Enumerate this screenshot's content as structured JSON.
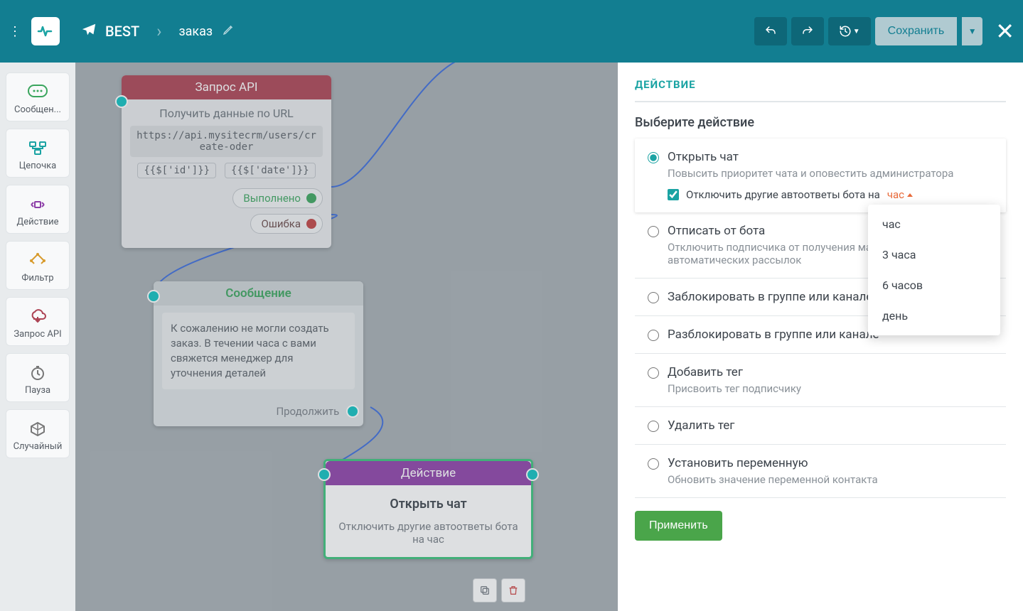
{
  "header": {
    "bot_name": "BEST",
    "flow_name": "заказ",
    "save": "Сохранить"
  },
  "tools": {
    "message": "Сообщен...",
    "chain": "Цепочка",
    "action": "Действие",
    "filter": "Фильтр",
    "api": "Запрос API",
    "pause": "Пауза",
    "random": "Случайный"
  },
  "nodes": {
    "api": {
      "title": "Запрос API",
      "desc": "Получить данные по URL",
      "url": "https://api.mysitecrm/users/create-oder",
      "var1": "{{$['id']}}",
      "var2": "{{$['date']}}",
      "out_done": "Выполнено",
      "out_err": "Ошибка"
    },
    "msg": {
      "title": "Сообщение",
      "text": "К сожалению не могли создать заказ. В течении часа с вами свяжется менеджер для уточнения деталей",
      "out_continue": "Продолжить"
    },
    "act": {
      "title": "Действие",
      "name": "Открыть чат",
      "sub": "Отключить другие автоответы бота на  час"
    }
  },
  "panel": {
    "heading": "ДЕЙСТВИЕ",
    "select_label": "Выберите действие",
    "apply": "Применить",
    "items": {
      "open": {
        "label": "Открыть чат",
        "desc": "Повысить приоритет чата и оповестить администратора",
        "chk": "Отключить другие автоответы бота на",
        "time": "час"
      },
      "unsub": {
        "label": "Отписать от бота",
        "desc": "Отключить подписчика от получения массовых и автоматических рассылок"
      },
      "block": {
        "label": "Заблокировать в группе или канале"
      },
      "unblock": {
        "label": "Разблокировать в группе или канале"
      },
      "addtag": {
        "label": "Добавить тег",
        "desc": "Присвоить тег подписчику"
      },
      "deltag": {
        "label": "Удалить тег"
      },
      "setvar": {
        "label": "Установить переменную",
        "desc": "Обновить значение переменной контакта"
      }
    },
    "dropdown": [
      "час",
      "3 часа",
      "6 часов",
      "день"
    ]
  }
}
